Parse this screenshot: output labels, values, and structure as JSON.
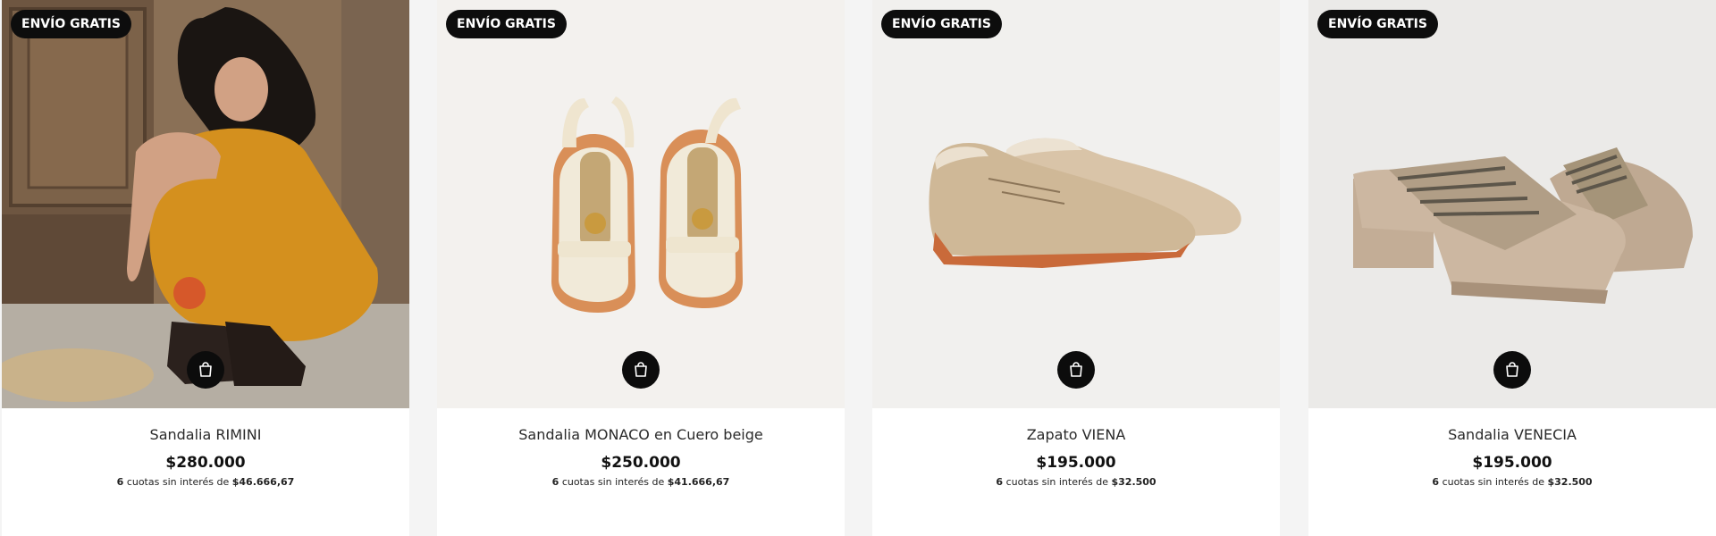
{
  "products": [
    {
      "badge": "ENVÍO GRATIS",
      "name": "Sandalia RIMINI",
      "price": "$280.000",
      "installments": {
        "count": "6",
        "text": "cuotas sin interés de",
        "amount": "$46.666,67"
      },
      "image_icon": "woman-sandals-photo"
    },
    {
      "badge": "ENVÍO GRATIS",
      "name": "Sandalia MONACO en Cuero beige",
      "price": "$250.000",
      "installments": {
        "count": "6",
        "text": "cuotas sin interés de",
        "amount": "$41.666,67"
      },
      "image_icon": "sandals-photo"
    },
    {
      "badge": "ENVÍO GRATIS",
      "name": "Zapato VIENA",
      "price": "$195.000",
      "installments": {
        "count": "6",
        "text": "cuotas sin interés de",
        "amount": "$32.500"
      },
      "image_icon": "oxford-shoes-photo"
    },
    {
      "badge": "ENVÍO GRATIS",
      "name": "Sandalia VENECIA",
      "price": "$195.000",
      "installments": {
        "count": "6",
        "text": "cuotas sin interés de",
        "amount": "$32.500"
      },
      "image_icon": "block-heel-sandals-photo"
    }
  ],
  "cart_icon": "shopping-bag-icon",
  "colors": {
    "badge_bg": "#0d0d0d",
    "badge_text": "#ffffff",
    "cart_button_bg": "#0c0c0c"
  }
}
